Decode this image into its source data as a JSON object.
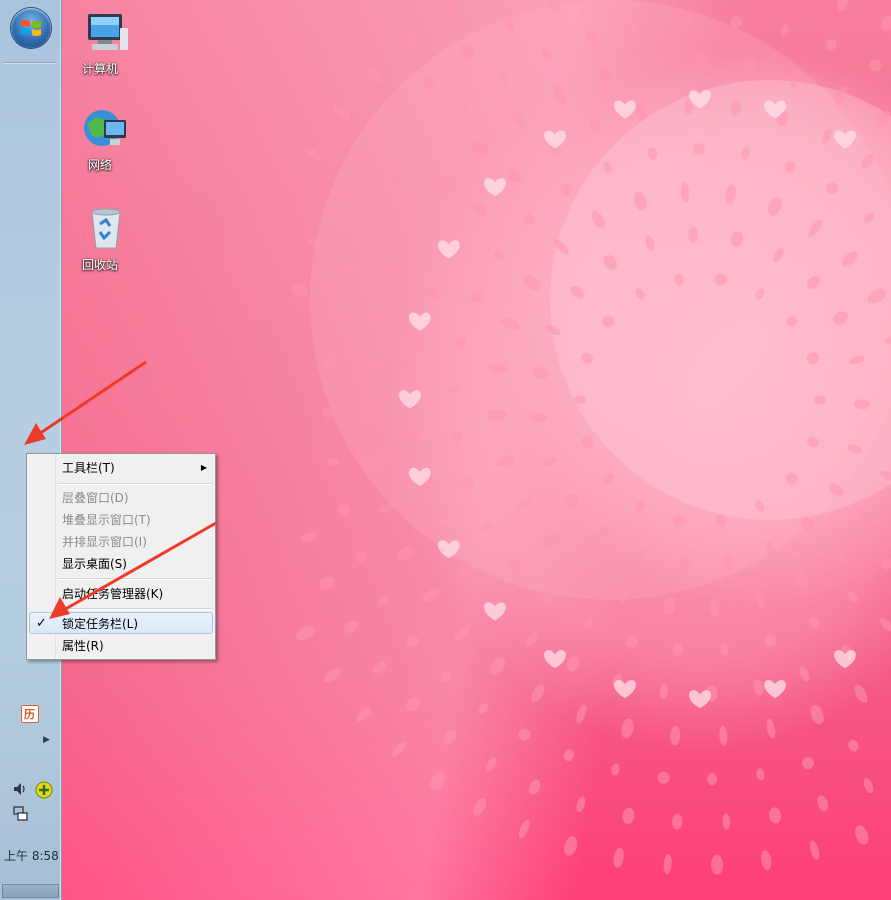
{
  "desktop": {
    "icons": [
      {
        "label": "计算机",
        "icon": "computer-icon"
      },
      {
        "label": "网络",
        "icon": "network-icon"
      },
      {
        "label": "回收站",
        "icon": "recycle-bin-icon"
      }
    ]
  },
  "taskbar": {
    "orientation": "vertical-left",
    "start_button_icon": "windows-start-orb",
    "tray": {
      "calendar_glyph": "历",
      "clock": "上午 8:58"
    }
  },
  "context_menu": {
    "items": [
      {
        "label": "工具栏(T)",
        "enabled": true,
        "submenu": true
      },
      {
        "label": "层叠窗口(D)",
        "enabled": false
      },
      {
        "label": "堆叠显示窗口(T)",
        "enabled": false
      },
      {
        "label": "并排显示窗口(I)",
        "enabled": false
      },
      {
        "label": "显示桌面(S)",
        "enabled": true
      },
      {
        "label": "启动任务管理器(K)",
        "enabled": true
      },
      {
        "label": "锁定任务栏(L)",
        "enabled": true,
        "checked": true,
        "highlighted": true
      },
      {
        "label": "属性(R)",
        "enabled": true
      }
    ],
    "check_glyph": "✓"
  },
  "colors": {
    "wallpaper": "#f46b8d",
    "taskbar": "#b5cfe2",
    "annotation_arrow": "#ee3a2b",
    "menu_highlight": "#dbe8f7"
  }
}
